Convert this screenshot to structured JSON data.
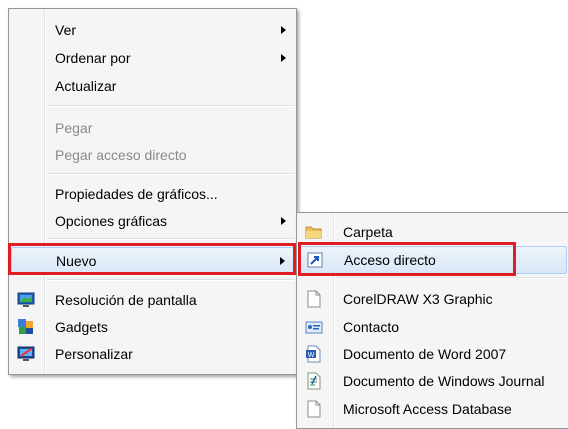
{
  "context_menu": {
    "items": [
      {
        "label": "Ver"
      },
      {
        "label": "Ordenar por"
      },
      {
        "label": "Actualizar"
      },
      {
        "label": "Pegar"
      },
      {
        "label": "Pegar acceso directo"
      },
      {
        "label": "Propiedades de gráficos..."
      },
      {
        "label": "Opciones gráficas"
      },
      {
        "label": "Nuevo"
      },
      {
        "label": "Resolución de pantalla"
      },
      {
        "label": "Gadgets"
      },
      {
        "label": "Personalizar"
      }
    ]
  },
  "submenu_nuevo": {
    "items": [
      {
        "label": "Carpeta"
      },
      {
        "label": "Acceso directo"
      },
      {
        "label": "CorelDRAW X3 Graphic"
      },
      {
        "label": "Contacto"
      },
      {
        "label": "Documento de Word 2007"
      },
      {
        "label": "Documento de Windows Journal"
      },
      {
        "label": "Microsoft Access Database"
      }
    ]
  },
  "colors": {
    "highlight_box": "#e11d24",
    "menu_bg": "#f5f5f5"
  }
}
